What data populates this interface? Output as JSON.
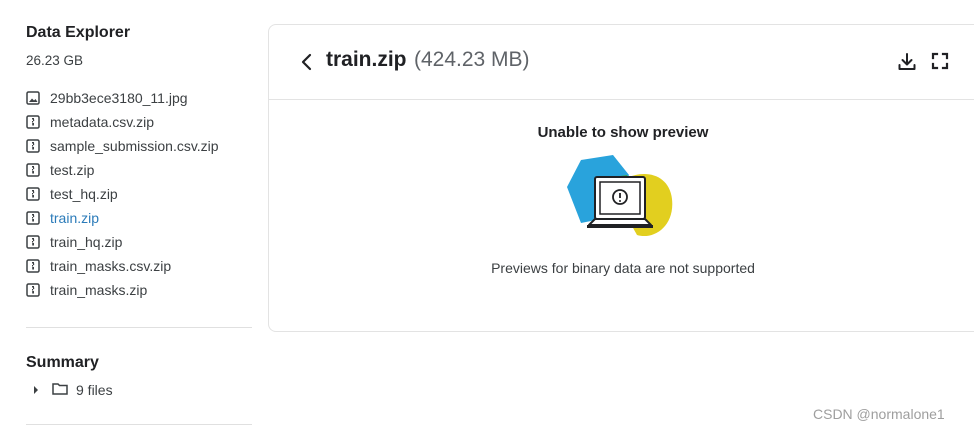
{
  "sidebar": {
    "title": "Data Explorer",
    "size": "26.23 GB",
    "files": [
      {
        "name": "29bb3ece3180_11.jpg",
        "icon": "image-file-icon",
        "active": false
      },
      {
        "name": "metadata.csv.zip",
        "icon": "zip-file-icon",
        "active": false
      },
      {
        "name": "sample_submission.csv.zip",
        "icon": "zip-file-icon",
        "active": false
      },
      {
        "name": "test.zip",
        "icon": "zip-file-icon",
        "active": false
      },
      {
        "name": "test_hq.zip",
        "icon": "zip-file-icon",
        "active": false
      },
      {
        "name": "train.zip",
        "icon": "zip-file-icon",
        "active": true
      },
      {
        "name": "train_hq.zip",
        "icon": "zip-file-icon",
        "active": false
      },
      {
        "name": "train_masks.csv.zip",
        "icon": "zip-file-icon",
        "active": false
      },
      {
        "name": "train_masks.zip",
        "icon": "zip-file-icon",
        "active": false
      }
    ],
    "summary": {
      "title": "Summary",
      "files_label": "9 files"
    }
  },
  "viewer": {
    "file_name": "train.zip",
    "file_size": "(424.23 MB)",
    "preview_title": "Unable to show preview",
    "preview_message": "Previews for binary data are not supported"
  },
  "watermark": "CSDN @normalone1",
  "colors": {
    "active_link": "#2b7bb9",
    "blob_blue": "#29a3dc",
    "blob_yellow": "#e2cf1f",
    "blob_green": "#3aa64a"
  }
}
